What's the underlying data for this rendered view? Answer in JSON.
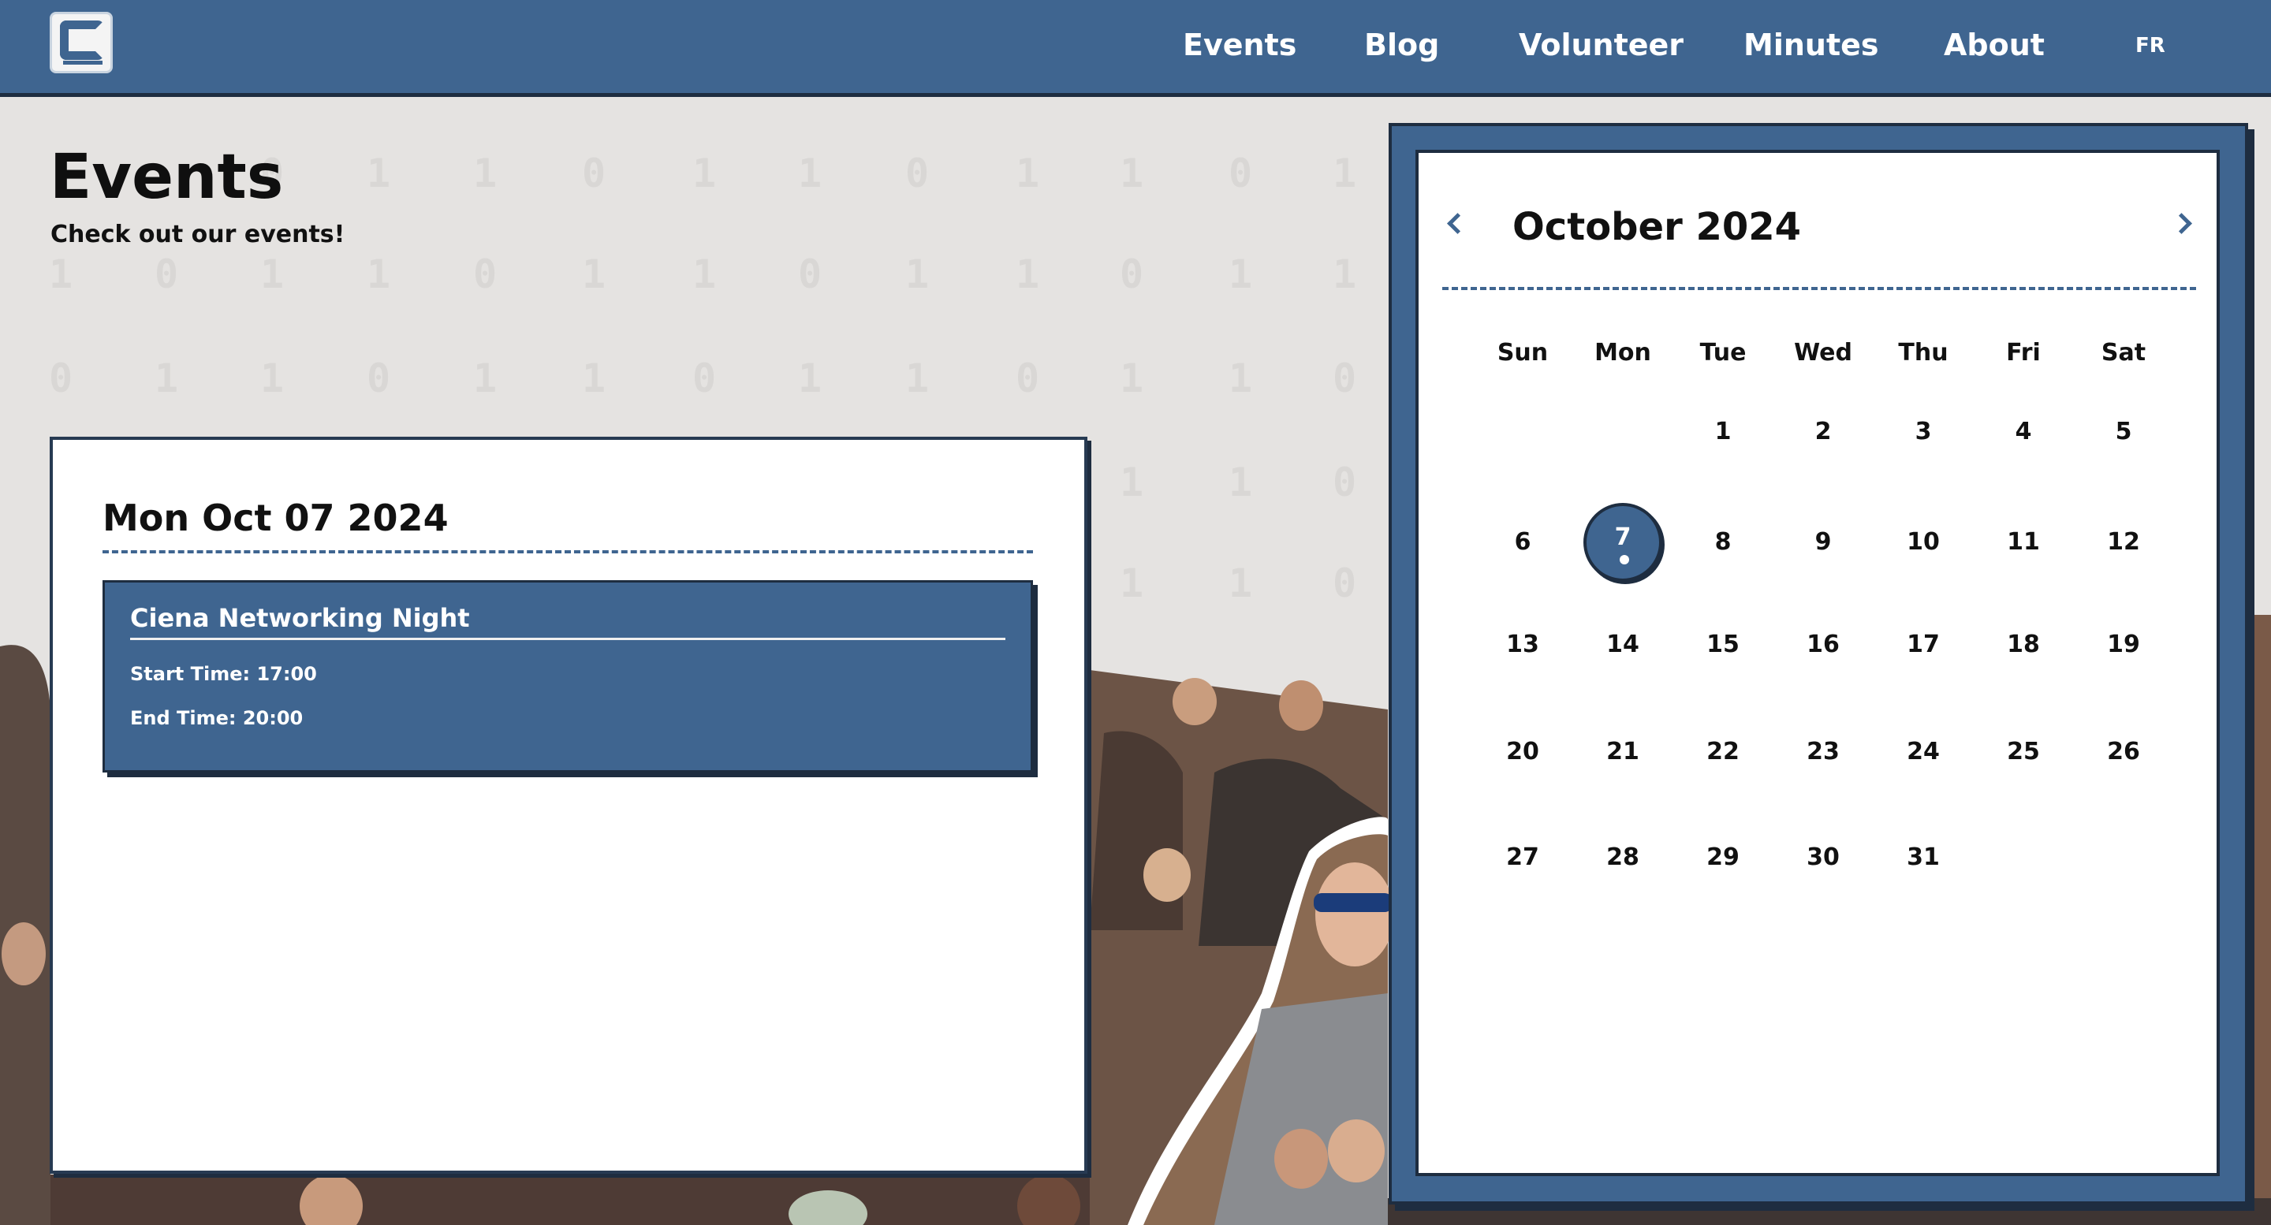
{
  "colors": {
    "primary": "#3f6590",
    "primary_dark": "#1e2d40",
    "page_bg": "#e5e3e1",
    "panel_bg": "#ffffff",
    "text": "#111111"
  },
  "nav": {
    "logo_icon": "club-c-logo-icon",
    "links": [
      {
        "label": "Events"
      },
      {
        "label": "Blog"
      },
      {
        "label": "Volunteer"
      },
      {
        "label": "Minutes"
      },
      {
        "label": "About"
      }
    ],
    "language_toggle": "FR"
  },
  "header": {
    "title": "Events",
    "subtitle": "Check out our events!"
  },
  "selected_date": {
    "heading": "Mon Oct 07 2024",
    "events": [
      {
        "name": "Ciena Networking Night",
        "start": "Start Time: 17:00",
        "end": "End Time: 20:00"
      }
    ]
  },
  "calendar": {
    "month_label": "October 2024",
    "prev_icon": "chevron-left-icon",
    "next_icon": "chevron-right-icon",
    "weekdays": [
      "Sun",
      "Mon",
      "Tue",
      "Wed",
      "Thu",
      "Fri",
      "Sat"
    ],
    "first_weekday_index": 2,
    "days_in_month": 31,
    "selected_day": 7,
    "event_days": [
      7
    ]
  }
}
